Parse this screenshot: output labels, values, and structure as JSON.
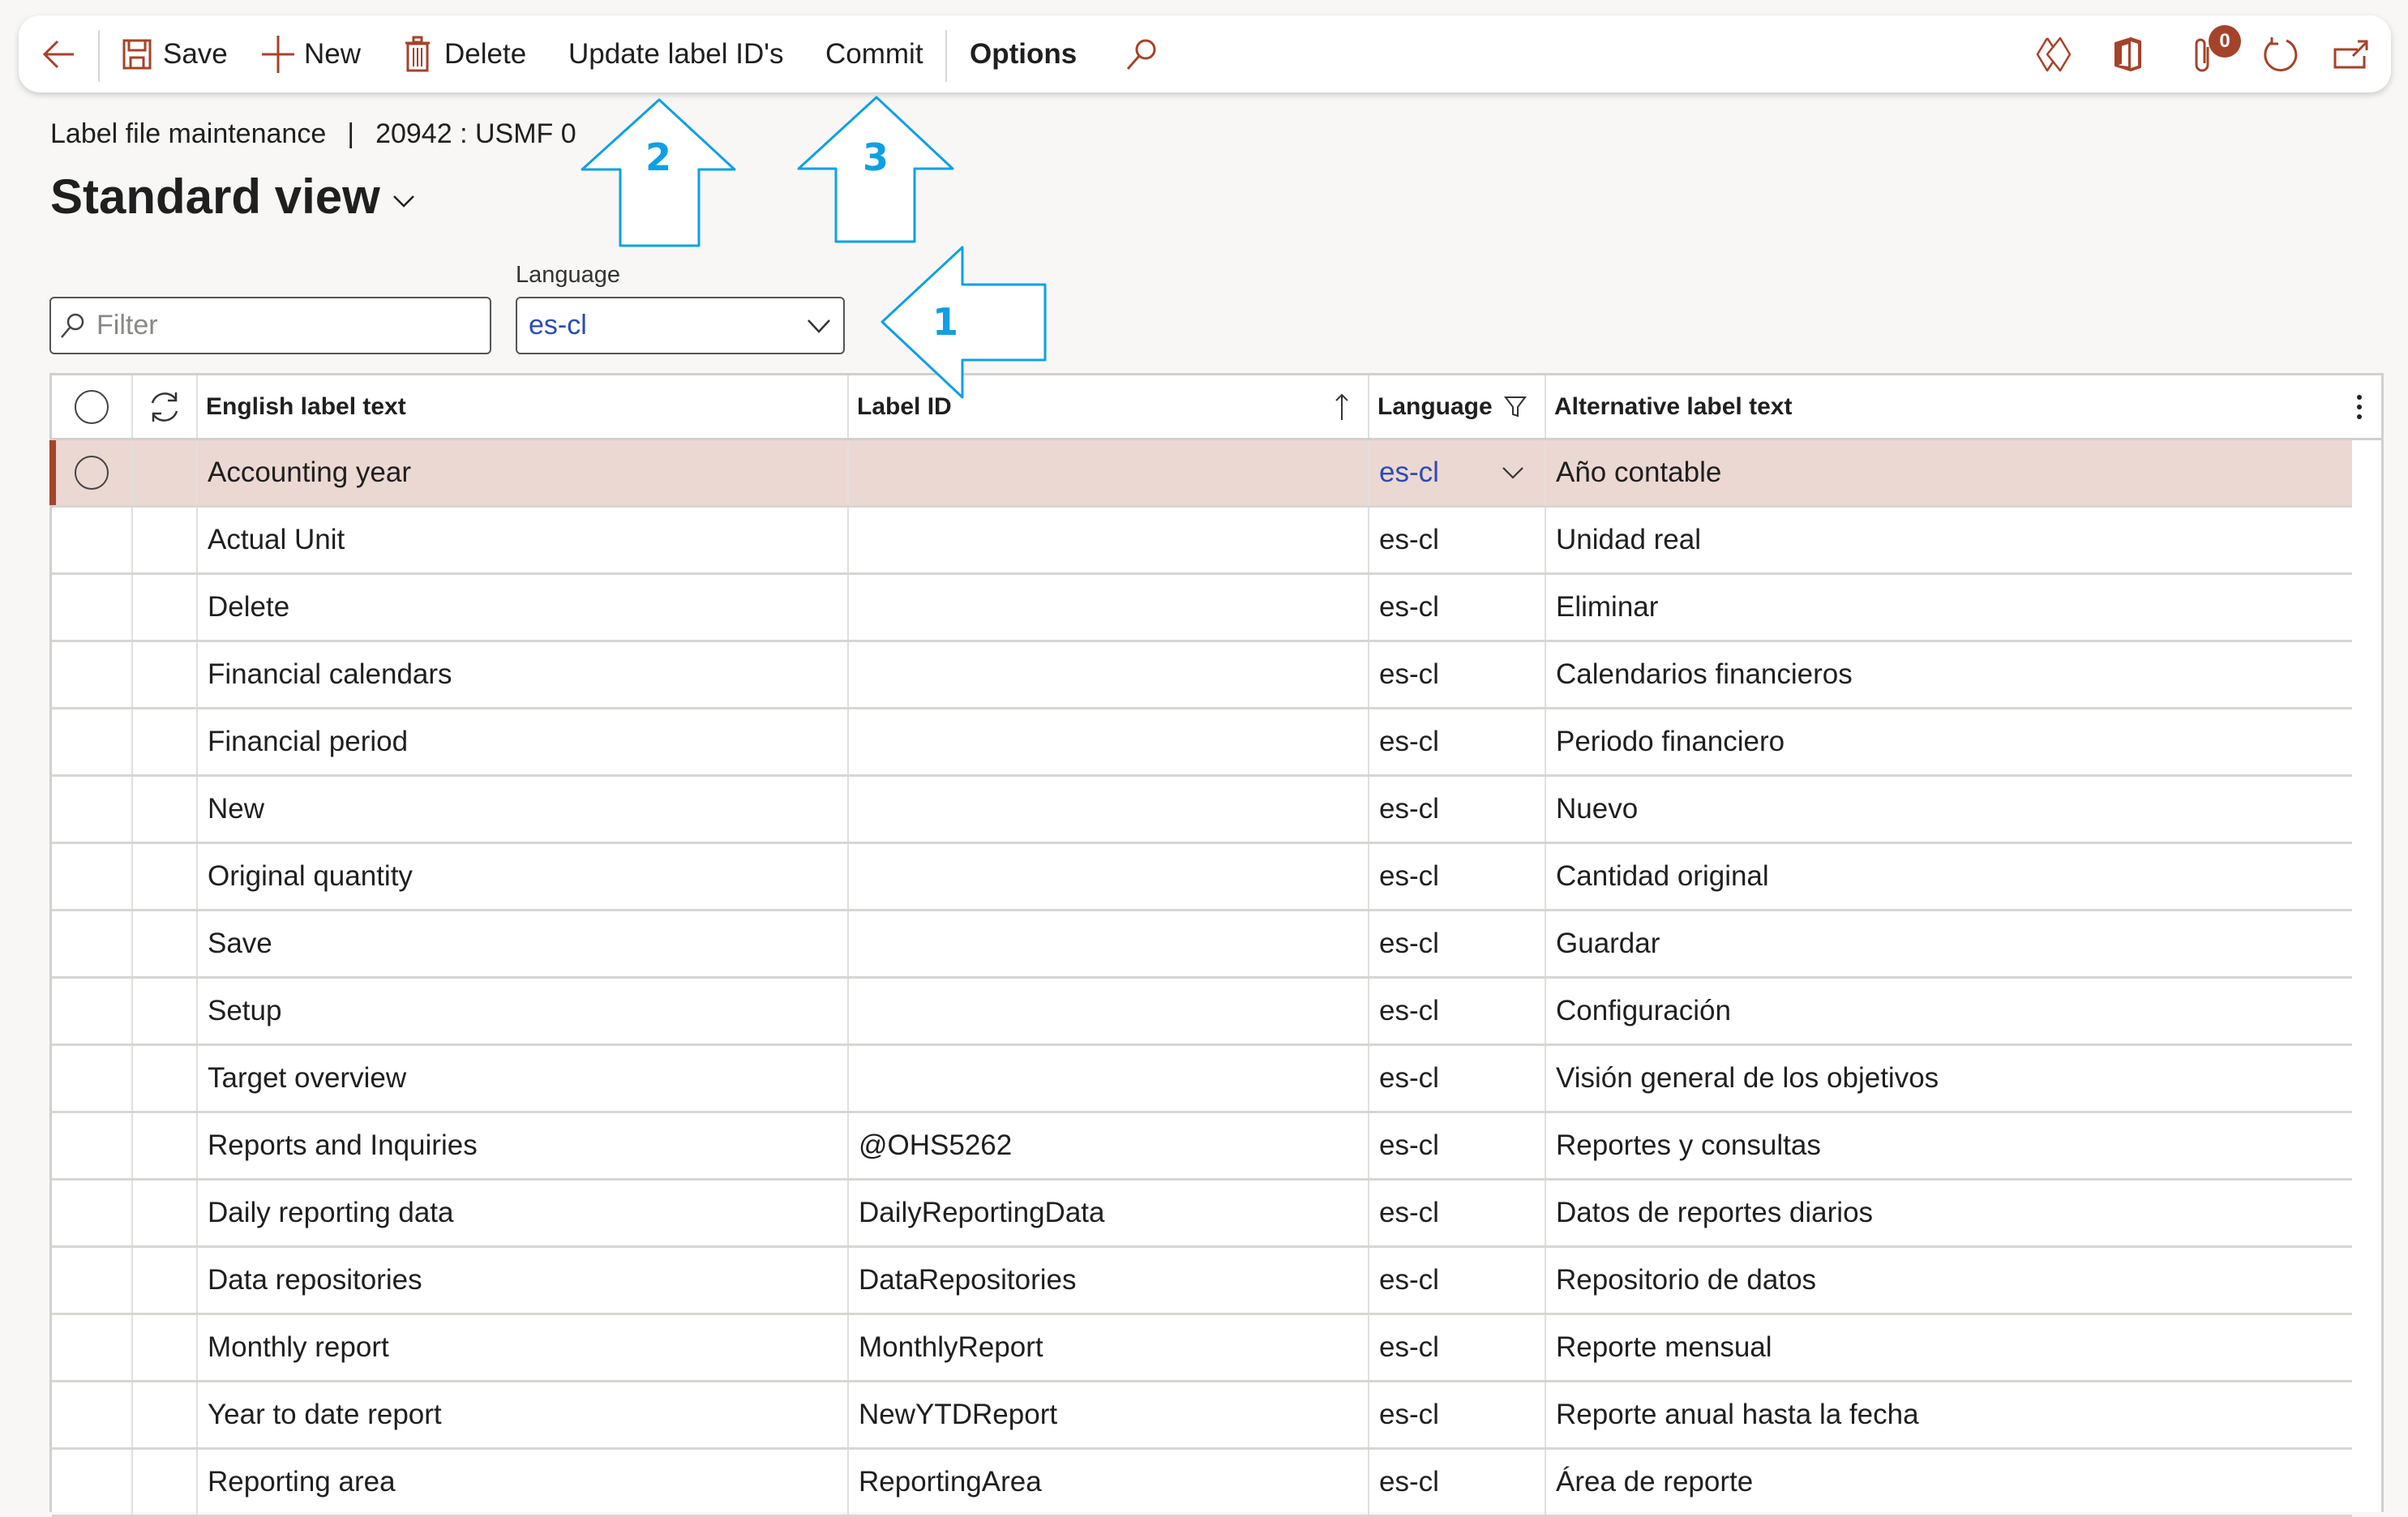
{
  "toolbar": {
    "back_icon": "arrow-left-icon",
    "items": [
      {
        "label": "Save",
        "icon": "save-icon"
      },
      {
        "label": "New",
        "icon": "plus-icon"
      },
      {
        "label": "Delete",
        "icon": "trash-icon"
      },
      {
        "label": "Update label ID's"
      },
      {
        "label": "Commit"
      },
      {
        "label": "Options"
      }
    ],
    "search_icon": "search-icon",
    "right_icons": [
      "power-apps-icon",
      "office-icon",
      "attachments-icon",
      "refresh-icon",
      "open-new-window-icon"
    ],
    "attachments_count": "0",
    "accent_color": "#a5432a"
  },
  "header": {
    "breadcrumb_page": "Label file maintenance",
    "breadcrumb_separator": "|",
    "breadcrumb_context": "20942 : USMF 0",
    "view_title": "Standard view"
  },
  "filters": {
    "filter_placeholder": "Filter",
    "filter_value": "",
    "language_label": "Language",
    "language_value": "es-cl"
  },
  "grid": {
    "columns": [
      {
        "label": ""
      },
      {
        "label": ""
      },
      {
        "label": "English label text"
      },
      {
        "label": "Label ID",
        "sort": "ascending"
      },
      {
        "label": "Language",
        "filtered": true
      },
      {
        "label": "Alternative label text"
      }
    ],
    "selected_row_color": "#ecd8d2",
    "rows": [
      {
        "english": "Accounting year",
        "label_id": "",
        "language": "es-cl",
        "alternative": "Año contable",
        "selected": true
      },
      {
        "english": "Actual Unit",
        "label_id": "",
        "language": "es-cl",
        "alternative": "Unidad real"
      },
      {
        "english": "Delete",
        "label_id": "",
        "language": "es-cl",
        "alternative": "Eliminar"
      },
      {
        "english": "Financial calendars",
        "label_id": "",
        "language": "es-cl",
        "alternative": "Calendarios financieros"
      },
      {
        "english": "Financial period",
        "label_id": "",
        "language": "es-cl",
        "alternative": "Periodo financiero"
      },
      {
        "english": "New",
        "label_id": "",
        "language": "es-cl",
        "alternative": "Nuevo"
      },
      {
        "english": "Original quantity",
        "label_id": "",
        "language": "es-cl",
        "alternative": "Cantidad original"
      },
      {
        "english": "Save",
        "label_id": "",
        "language": "es-cl",
        "alternative": "Guardar"
      },
      {
        "english": "Setup",
        "label_id": "",
        "language": "es-cl",
        "alternative": "Configuración"
      },
      {
        "english": "Target overview",
        "label_id": "",
        "language": "es-cl",
        "alternative": "Visión general de los objetivos"
      },
      {
        "english": "Reports and Inquiries",
        "label_id": "@OHS5262",
        "language": "es-cl",
        "alternative": "Reportes y consultas"
      },
      {
        "english": "Daily reporting data",
        "label_id": "DailyReportingData",
        "language": "es-cl",
        "alternative": "Datos de reportes diarios"
      },
      {
        "english": "Data repositories",
        "label_id": "DataRepositories",
        "language": "es-cl",
        "alternative": "Repositorio de datos"
      },
      {
        "english": "Monthly report",
        "label_id": "MonthlyReport",
        "language": "es-cl",
        "alternative": "Reporte mensual"
      },
      {
        "english": "Year to date report",
        "label_id": "NewYTDReport",
        "language": "es-cl",
        "alternative": "Reporte anual hasta la fecha"
      },
      {
        "english": "Reporting area",
        "label_id": "ReportingArea",
        "language": "es-cl",
        "alternative": "Área de reporte"
      }
    ]
  },
  "callouts": [
    {
      "number": "1",
      "points_to": "Language filter"
    },
    {
      "number": "2",
      "points_to": "Update label ID's"
    },
    {
      "number": "3",
      "points_to": "Commit"
    }
  ],
  "callout_color": "#0ea0e4"
}
